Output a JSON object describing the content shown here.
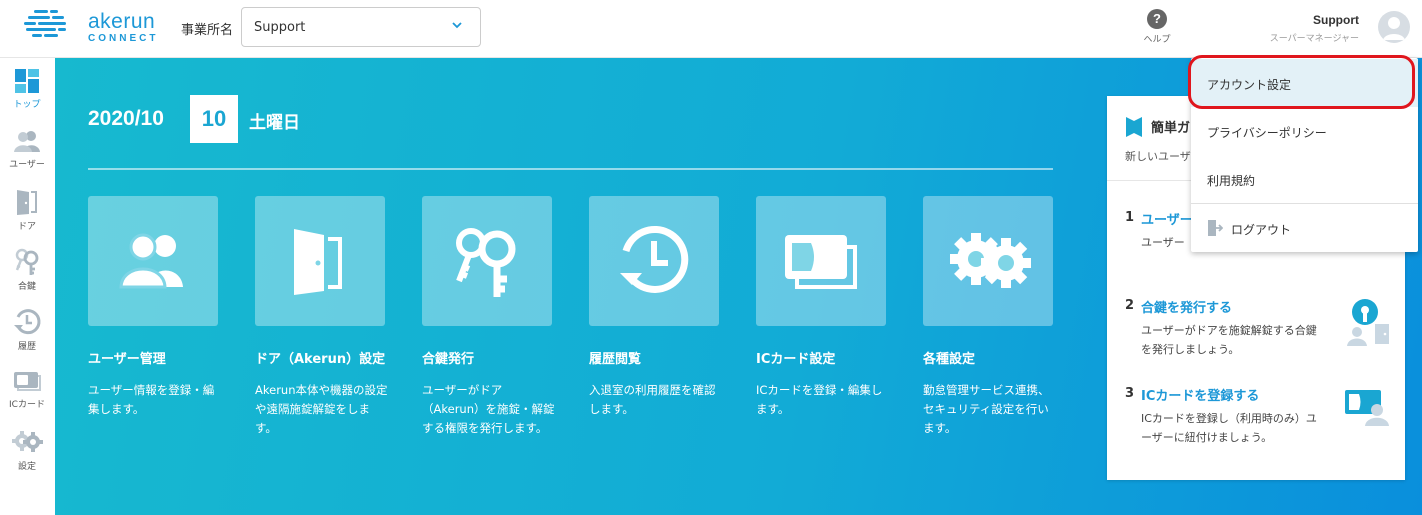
{
  "brand": {
    "name": "akerun",
    "sub": "CONNECT",
    "color": "#1d98d7"
  },
  "header": {
    "office_label": "事業所名",
    "office_value": "Support",
    "help_label": "ヘルプ",
    "user_name": "Support",
    "user_role": "スーパーマネージャー"
  },
  "sidebar": {
    "items": [
      {
        "label": "トップ",
        "icon": "dashboard-icon"
      },
      {
        "label": "ユーザー",
        "icon": "users-icon"
      },
      {
        "label": "ドア",
        "icon": "door-icon"
      },
      {
        "label": "合鍵",
        "icon": "key-icon"
      },
      {
        "label": "履歴",
        "icon": "history-icon"
      },
      {
        "label": "ICカード",
        "icon": "ic-card-icon"
      },
      {
        "label": "設定",
        "icon": "gear-icon"
      }
    ]
  },
  "main": {
    "date_ym": "2020/10",
    "date_day": "10",
    "date_weekday": "土曜日",
    "cards": [
      {
        "title": "ユーザー管理",
        "desc": "ユーザー情報を登録・編集します。",
        "icon": "users-icon"
      },
      {
        "title": "ドア（Akerun）設定",
        "desc": "Akerun本体や機器の設定や遠隔施錠解錠をします。",
        "icon": "door-icon"
      },
      {
        "title": "合鍵発行",
        "desc": "ユーザーがドア（Akerun）を施錠・解錠する権限を発行します。",
        "icon": "key-icon"
      },
      {
        "title": "履歴閲覧",
        "desc": "入退室の利用履歴を確認します。",
        "icon": "history-icon"
      },
      {
        "title": "ICカード設定",
        "desc": "ICカードを登録・編集します。",
        "icon": "ic-card-icon"
      },
      {
        "title": "各種設定",
        "desc": "勤怠管理サービス連携、セキュリティ設定を行います。",
        "icon": "gear-icon"
      }
    ]
  },
  "guide": {
    "title": "簡単ガ",
    "sub": "新しいユーザ",
    "steps": [
      {
        "num": "1",
        "title": "ユーザー",
        "desc": "ユーザー"
      },
      {
        "num": "2",
        "title": "合鍵を発行する",
        "desc": "ユーザーがドアを施錠解錠する合鍵を発行しましょう。"
      },
      {
        "num": "3",
        "title": "ICカードを登録する",
        "desc": "ICカードを登録し（利用時のみ）ユーザーに紐付けましょう。"
      }
    ]
  },
  "menu": {
    "items": [
      {
        "label": "アカウント設定"
      },
      {
        "label": "プライバシーポリシー"
      },
      {
        "label": "利用規約"
      },
      {
        "label": "ログアウト",
        "icon": "logout-icon"
      }
    ]
  }
}
